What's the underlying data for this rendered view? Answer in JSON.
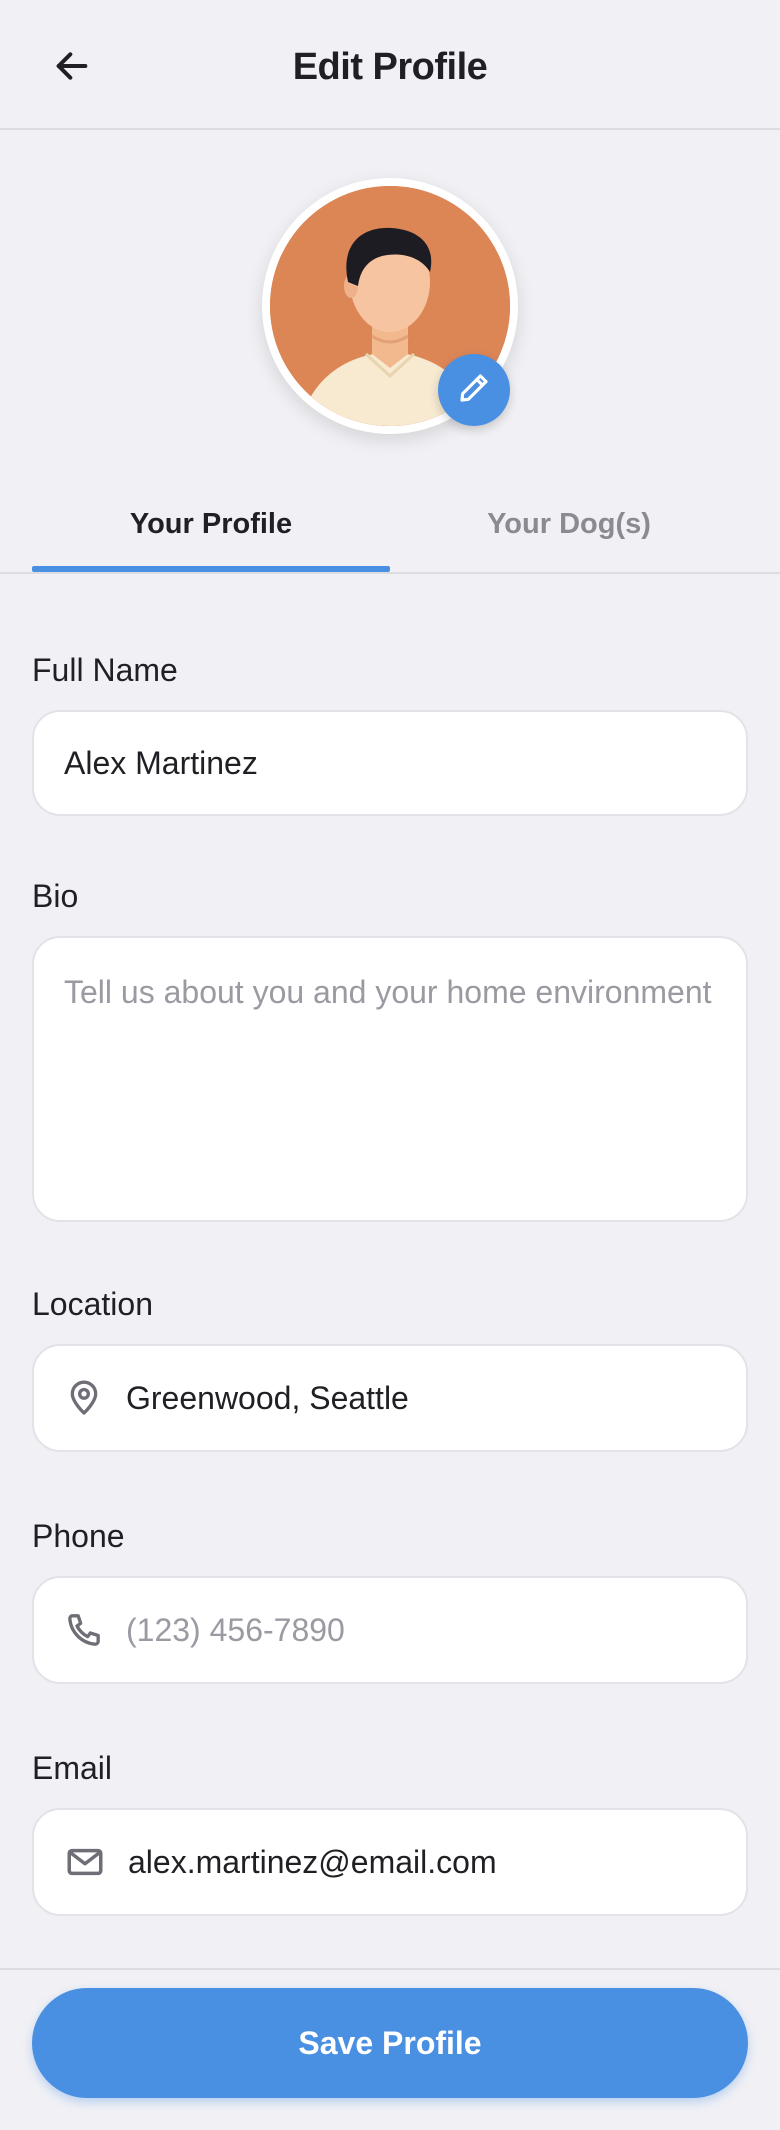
{
  "header": {
    "title": "Edit Profile",
    "back_icon": "arrow-left-icon"
  },
  "avatar": {
    "edit_icon": "pencil-icon",
    "accent": "#4a90e2"
  },
  "tabs": [
    {
      "label": "Your Profile",
      "active": true
    },
    {
      "label": "Your Dog(s)",
      "active": false
    }
  ],
  "form": {
    "full_name": {
      "label": "Full Name",
      "value": "Alex Martinez"
    },
    "bio": {
      "label": "Bio",
      "value": "",
      "placeholder": "Tell us about you and your home environment"
    },
    "location": {
      "label": "Location",
      "value": "Greenwood, Seattle",
      "icon": "map-pin-icon"
    },
    "phone": {
      "label": "Phone",
      "value": "",
      "placeholder": "(123) 456-7890",
      "icon": "phone-icon"
    },
    "email": {
      "label": "Email",
      "value": "alex.martinez@email.com",
      "icon": "mail-icon"
    }
  },
  "footer": {
    "save_label": "Save Profile"
  },
  "colors": {
    "accent": "#4a90e2",
    "background": "#f1f1f5",
    "text": "#1f1f24",
    "muted": "#8a8a92"
  }
}
